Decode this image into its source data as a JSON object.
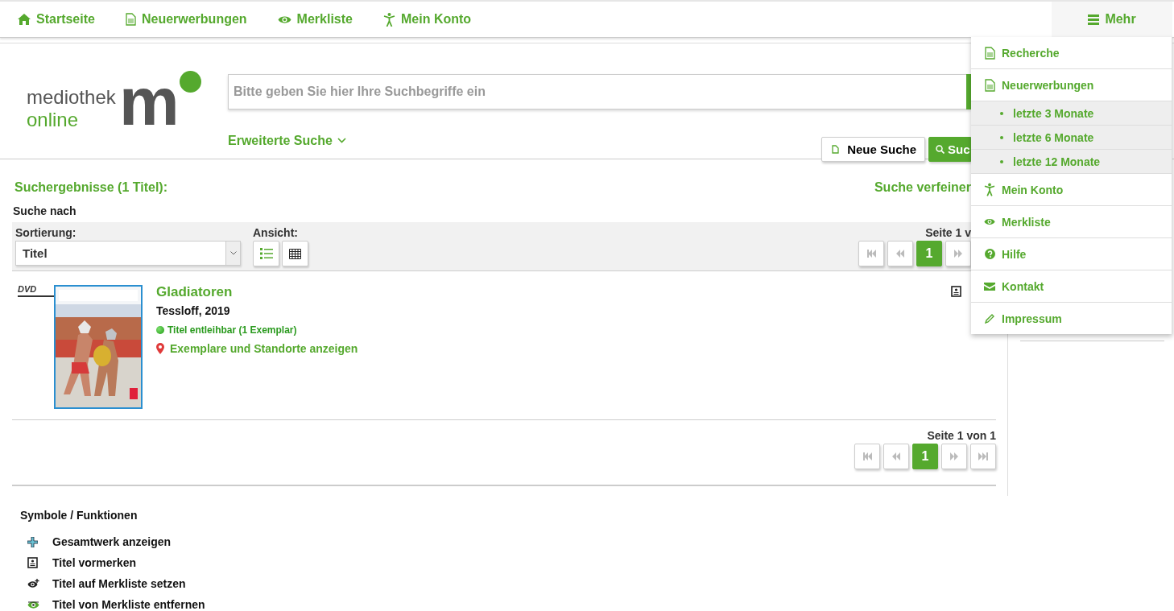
{
  "top_nav": {
    "items": [
      {
        "label": "Startseite",
        "kind": "home"
      },
      {
        "label": "Neuerwerbungen",
        "kind": "document"
      },
      {
        "label": "Merkliste",
        "kind": "eye"
      },
      {
        "label": "Mein Konto",
        "kind": "person"
      }
    ],
    "more": {
      "label": "Mehr",
      "expanded": true
    }
  },
  "header": {
    "logo": {
      "line_1": "mediothek",
      "line_2": "online",
      "letter": "m"
    },
    "search": {
      "placeholder": "Bitte geben Sie hier Ihre Suchbegriffe ein",
      "advanced_link": "Erweiterte Suche",
      "new_search_button": "Neue Suche",
      "search_button": "Suc"
    }
  },
  "results": {
    "heading": "Suchergebnisse (1 Titel):",
    "refine_link": "Suche verfeiner",
    "query_label": "Suche nach",
    "sort": {
      "label": "Sortierung:",
      "value": "Titel"
    },
    "view": {
      "label": "Ansicht:",
      "options": [
        {
          "kind": "list",
          "selected": true
        },
        {
          "kind": "grid",
          "selected": false
        }
      ]
    },
    "pager_top": {
      "label": "Seite 1 v",
      "pages": [
        {
          "label": "1",
          "selected": true
        }
      ]
    },
    "items": [
      {
        "media": "DVD",
        "title": "Gladiatoren",
        "publisher": "Tessloff, 2019",
        "availability": "Titel entleihbar (1 Exemplar)",
        "available": true,
        "locations_link": "Exemplare und Standorte anzeigen"
      }
    ],
    "pager_bottom": {
      "label": "Seite 1 von 1",
      "pages": [
        {
          "label": "1",
          "selected": true
        }
      ]
    }
  },
  "legend": {
    "title": "Symbole / Funktionen",
    "items": [
      {
        "kind": "plus",
        "label": "Gesamtwerk anzeigen"
      },
      {
        "kind": "reserve",
        "label": "Titel vormerken"
      },
      {
        "kind": "eye-plus",
        "label": "Titel auf Merkliste setzen"
      },
      {
        "kind": "eye-remove",
        "label": "Titel von Merkliste entfernen"
      }
    ]
  },
  "more_menu": {
    "items": [
      {
        "label": "Recherche",
        "kind": "document"
      },
      {
        "label": "Neuerwerbungen",
        "kind": "document",
        "children": [
          {
            "label": "letzte 3 Monate"
          },
          {
            "label": "letzte 6 Monate"
          },
          {
            "label": "letzte 12 Monate"
          }
        ]
      },
      {
        "label": "Mein Konto",
        "kind": "person"
      },
      {
        "label": "Merkliste",
        "kind": "eye"
      },
      {
        "label": "Hilfe",
        "kind": "help"
      },
      {
        "label": "Kontakt",
        "kind": "mail"
      },
      {
        "label": "Impressum",
        "kind": "pencil"
      }
    ]
  }
}
